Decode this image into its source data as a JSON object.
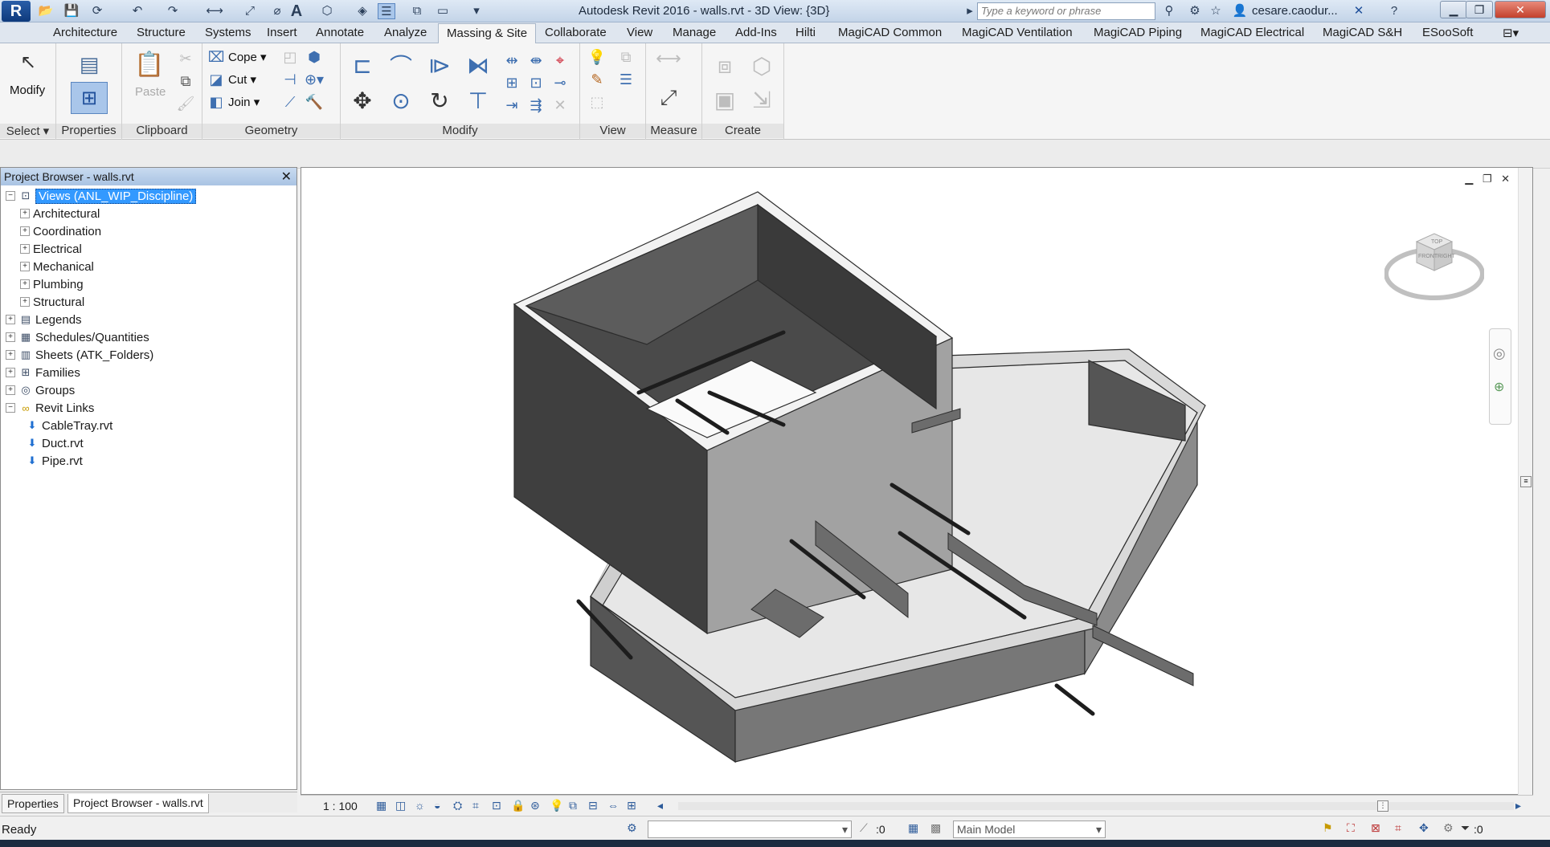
{
  "titlebar": {
    "title": "Autodesk Revit 2016 -     walls.rvt - 3D View: {3D}",
    "search_placeholder": "Type a keyword or phrase",
    "user": "cesare.caodur...",
    "app_letter": "R"
  },
  "ribbon_tabs": [
    "Architecture",
    "Structure",
    "Systems",
    "Insert",
    "Annotate",
    "Analyze",
    "Massing & Site",
    "Collaborate",
    "View",
    "Manage",
    "Add-Ins",
    "Hilti",
    "MagiCAD Common",
    "MagiCAD Ventilation",
    "MagiCAD Piping",
    "MagiCAD Electrical",
    "MagiCAD S&H",
    "ESooSoft"
  ],
  "ribbon_active_tab": "Massing & Site",
  "ribbon": {
    "modify_label": "Modify",
    "paste_label": "Paste",
    "cope_label": "Cope",
    "cut_label": "Cut",
    "join_label": "Join",
    "panels": {
      "select": "Select",
      "properties": "Properties",
      "clipboard": "Clipboard",
      "geometry": "Geometry",
      "modify": "Modify",
      "view": "View",
      "measure": "Measure",
      "create": "Create"
    }
  },
  "project_browser": {
    "title": "Project Browser - walls.rvt",
    "tree": [
      {
        "label": "Views (ANL_WIP_Discipline)",
        "level": 0,
        "expander": "−",
        "icon": "views-icon",
        "selected": true
      },
      {
        "label": "Architectural",
        "level": 1,
        "expander": "+"
      },
      {
        "label": "Coordination",
        "level": 1,
        "expander": "+"
      },
      {
        "label": "Electrical",
        "level": 1,
        "expander": "+"
      },
      {
        "label": "Mechanical",
        "level": 1,
        "expander": "+"
      },
      {
        "label": "Plumbing",
        "level": 1,
        "expander": "+"
      },
      {
        "label": "Structural",
        "level": 1,
        "expander": "+"
      },
      {
        "label": "Legends",
        "level": 0,
        "expander": "+",
        "icon": "legends-icon"
      },
      {
        "label": "Schedules/Quantities",
        "level": 0,
        "expander": "+",
        "icon": "schedules-icon"
      },
      {
        "label": "Sheets (ATK_Folders)",
        "level": 0,
        "expander": "+",
        "icon": "sheets-icon"
      },
      {
        "label": "Families",
        "level": 0,
        "expander": "+",
        "icon": "families-icon"
      },
      {
        "label": "Groups",
        "level": 0,
        "expander": "+",
        "icon": "groups-icon"
      },
      {
        "label": "Revit Links",
        "level": 0,
        "expander": "−",
        "icon": "revit-links-icon"
      },
      {
        "label": "CableTray.rvt",
        "level": 1,
        "icon": "link-file-icon"
      },
      {
        "label": "Duct.rvt",
        "level": 1,
        "icon": "link-file-icon"
      },
      {
        "label": "Pipe.rvt",
        "level": 1,
        "icon": "link-file-icon"
      }
    ],
    "tabs": [
      "Properties",
      "Project Browser - walls.rvt"
    ]
  },
  "viewcube": {
    "top": "TOP",
    "front": "FRONT",
    "right": "RIGHT"
  },
  "viewbar": {
    "scale": "1 : 100"
  },
  "statusbar": {
    "status": "Ready",
    "count": ":0",
    "workset": "Main Model",
    "filter_count": ":0"
  }
}
